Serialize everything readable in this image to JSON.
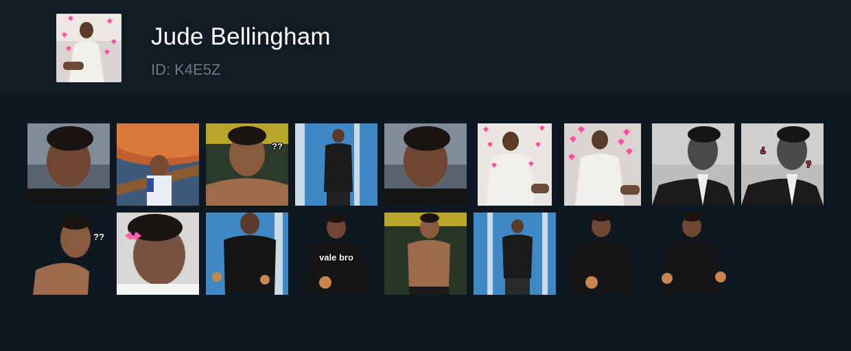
{
  "pack": {
    "title": "Jude Bellingham",
    "id_text": "ID: K4E5Z"
  },
  "stickers": [
    {
      "kind": "face-closeup-grimace"
    },
    {
      "kind": "scream-painting"
    },
    {
      "kind": "shirtless-thinking",
      "badge": "??"
    },
    {
      "kind": "standing-blue-wall"
    },
    {
      "kind": "face-closeup-grimace"
    },
    {
      "kind": "white-shirt-hearts"
    },
    {
      "kind": "white-shirt-hearts"
    },
    {
      "kind": "bw-suit"
    },
    {
      "kind": "bw-suit-question",
      "badge_left": "¿",
      "badge_right": "?"
    },
    {
      "kind": "shirtless-thinking-cutout",
      "badge": "??"
    },
    {
      "kind": "face-bow"
    },
    {
      "kind": "thumbs-up-blue-wall"
    },
    {
      "kind": "thumbs-cutout",
      "label": "vale bro"
    },
    {
      "kind": "shirtless-stadium"
    },
    {
      "kind": "standing-blue-wall-small"
    },
    {
      "kind": "thumbs-cutout"
    },
    {
      "kind": "thumbs-cutout-two"
    }
  ],
  "colors": {
    "background": "#0f1821",
    "header": "#121b24",
    "id_text": "#6f7882"
  }
}
